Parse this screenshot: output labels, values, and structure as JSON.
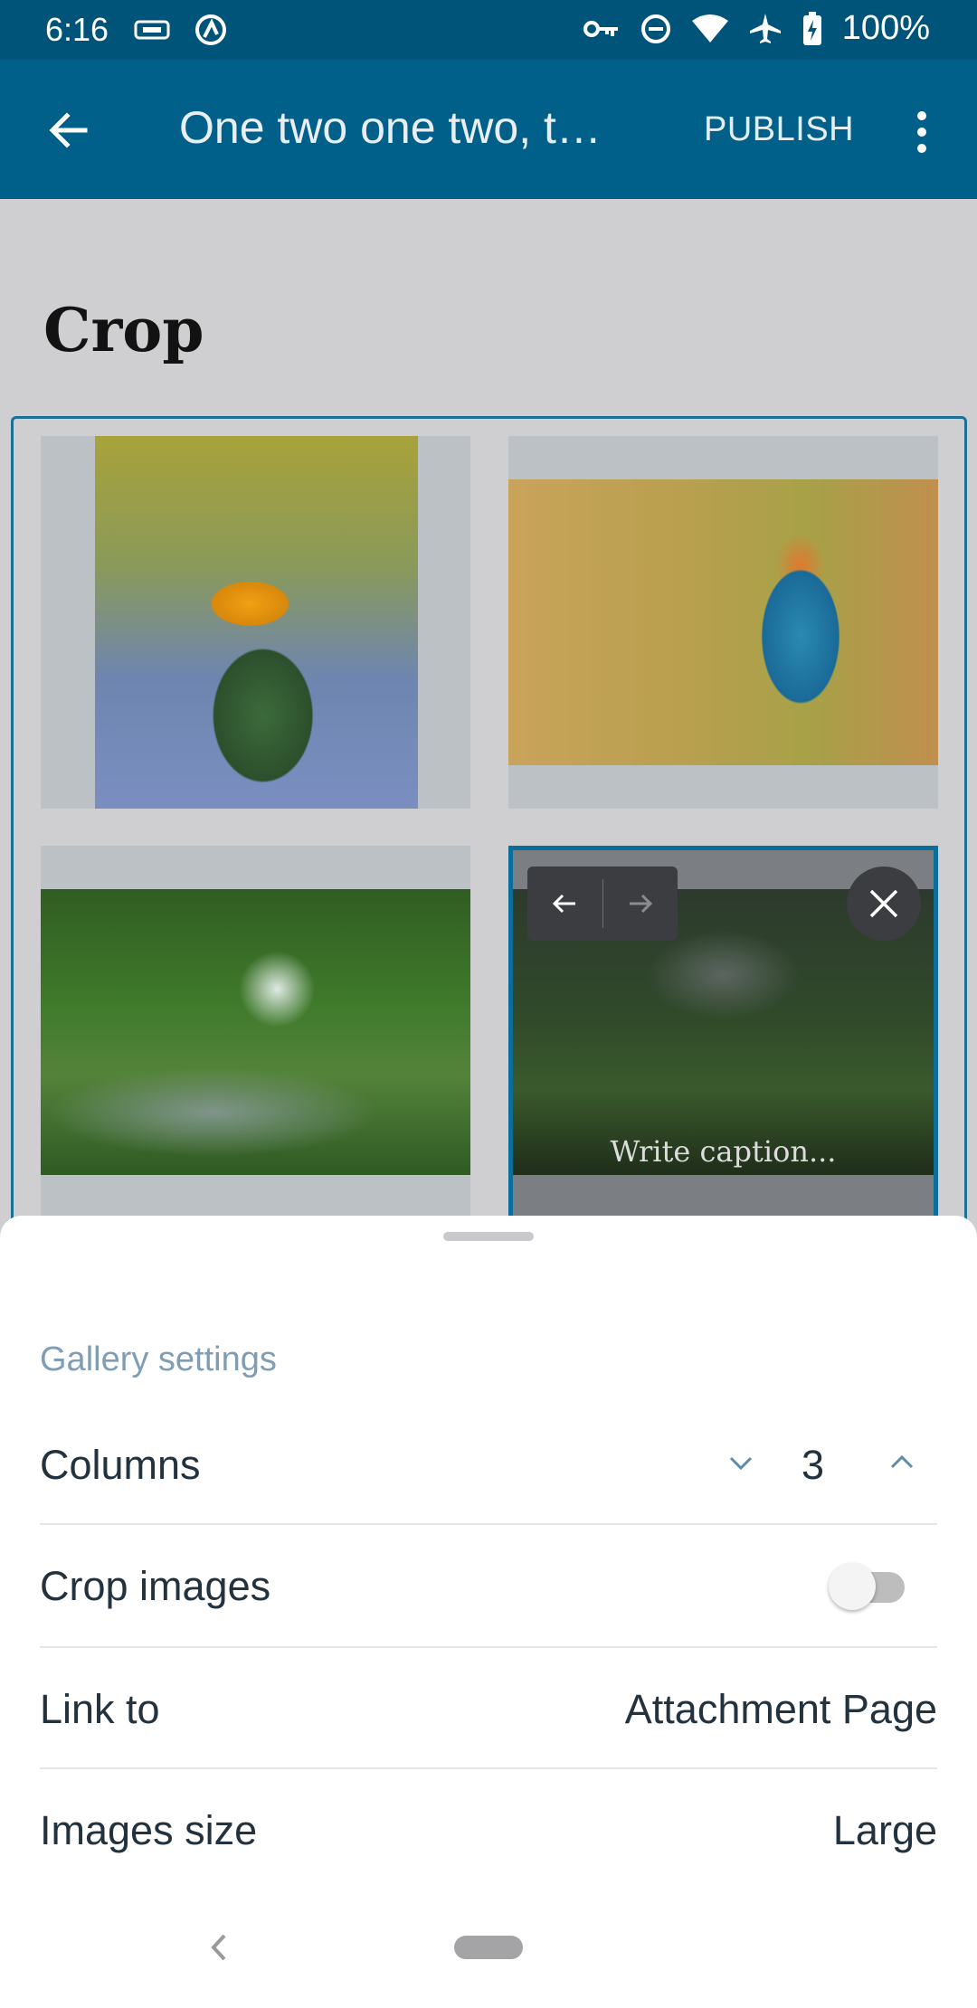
{
  "status_bar": {
    "time": "6:16",
    "battery": "100%",
    "icons": [
      "data-saver-icon",
      "circle-a-icon",
      "vpn-key-icon",
      "do-not-disturb-icon",
      "wifi-icon",
      "airplane-icon",
      "battery-charging-icon"
    ]
  },
  "app_bar": {
    "title": "One two one two, t…",
    "publish_label": "PUBLISH"
  },
  "editor": {
    "heading": "Crop",
    "gallery": {
      "images": [
        "oriole-on-cactus",
        "kingfisher",
        "forest-stream",
        "ferns"
      ],
      "caption_placeholder": "Write caption..."
    }
  },
  "sheet": {
    "title": "Gallery settings",
    "columns": {
      "label": "Columns",
      "value": "3"
    },
    "crop": {
      "label": "Crop images",
      "enabled": false
    },
    "link_to": {
      "label": "Link to",
      "value": "Attachment Page"
    },
    "image_size": {
      "label": "Images size",
      "value": "Large"
    }
  },
  "colors": {
    "status_bar": "#00547a",
    "app_bar": "#006089",
    "selection_accent": "#0a6d9c",
    "sheet_title": "#7f9db5"
  }
}
